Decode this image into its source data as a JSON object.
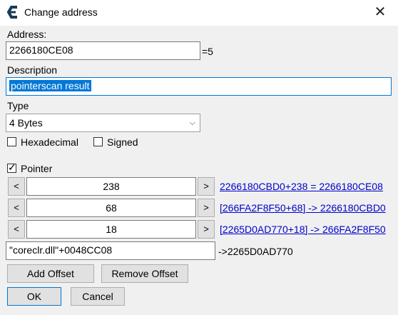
{
  "window": {
    "title": "Change address"
  },
  "address": {
    "label": "Address:",
    "value": "2266180CE08",
    "suffix": "=5"
  },
  "description": {
    "label": "Description",
    "value": "pointerscan result"
  },
  "type": {
    "label": "Type",
    "selected": "4 Bytes"
  },
  "options": {
    "hexadecimal": "Hexadecimal",
    "signed": "Signed"
  },
  "pointer": {
    "label": "Pointer",
    "checked": true,
    "offsets": [
      {
        "dec": "<",
        "value": "238",
        "inc": ">",
        "result": "2266180CBD0+238 = 2266180CE08"
      },
      {
        "dec": "<",
        "value": "68",
        "inc": ">",
        "result": "[266FA2F8F50+68] -> 2266180CBD0"
      },
      {
        "dec": "<",
        "value": "18",
        "inc": ">",
        "result": "[2265D0AD770+18] -> 266FA2F8F50"
      }
    ],
    "base": {
      "value": "\"coreclr.dll\"+0048CC08",
      "result": "->2265D0AD770"
    }
  },
  "buttons": {
    "add_offset": "Add Offset",
    "remove_offset": "Remove Offset",
    "ok": "OK",
    "cancel": "Cancel"
  },
  "icons": {
    "close": "close-icon",
    "chevron": "chevron-down-icon",
    "app": "cheat-engine-icon"
  },
  "colors": {
    "accent": "#0078d7",
    "link": "#0000cc"
  }
}
